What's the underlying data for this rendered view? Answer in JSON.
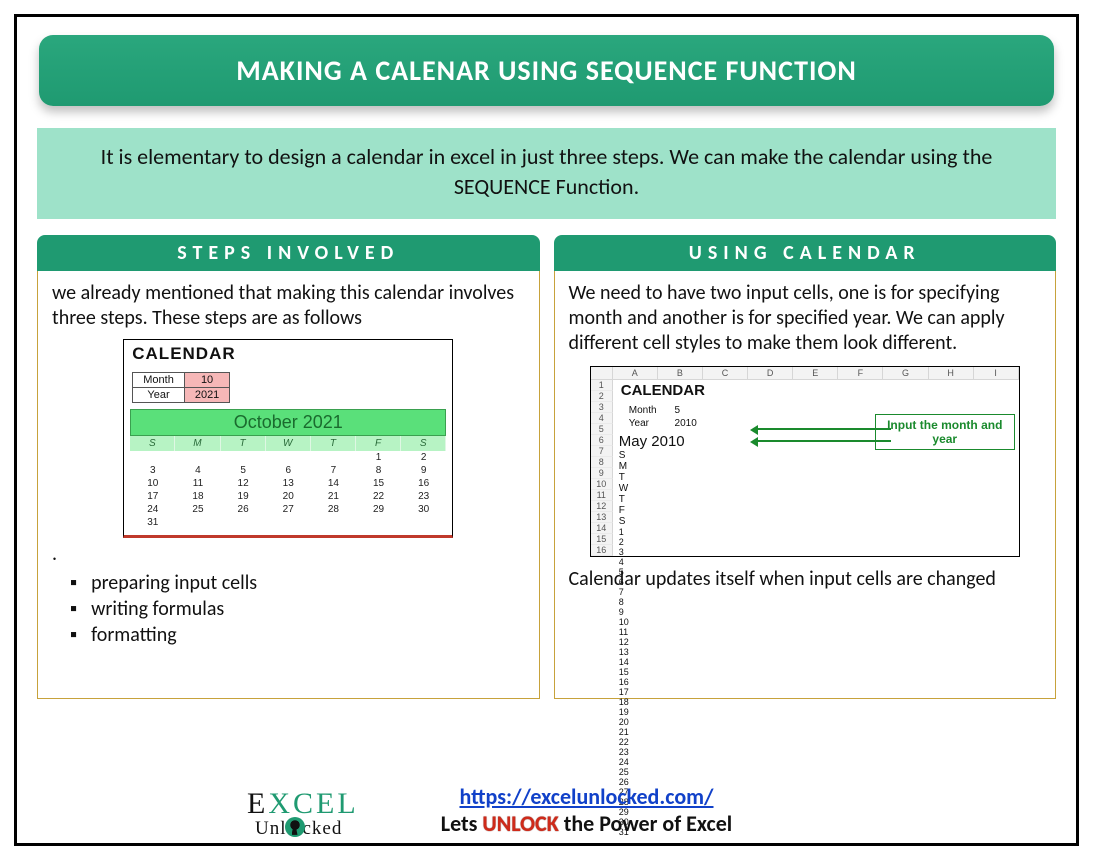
{
  "title": "MAKING A CALENAR USING SEQUENCE FUNCTION",
  "intro": "It is elementary to design a calendar in excel in just three steps. We can make the calendar using the SEQUENCE Function.",
  "left": {
    "header": "STEPS INVOLVED",
    "lead": "we already mentioned that making this calendar involves three steps. These steps are as follows",
    "dot": ".",
    "bullets": [
      "preparing input cells",
      "writing formulas",
      "formatting"
    ],
    "calendar": {
      "title": "CALENDAR",
      "month_label": "Month",
      "year_label": "Year",
      "month_value": "10",
      "year_value": "2021",
      "month_band": "October 2021",
      "dow": [
        "S",
        "M",
        "T",
        "W",
        "T",
        "F",
        "S"
      ],
      "grid": [
        [
          "",
          "",
          "",
          "",
          "",
          "1",
          "2"
        ],
        [
          "3",
          "4",
          "5",
          "6",
          "7",
          "8",
          "9"
        ],
        [
          "10",
          "11",
          "12",
          "13",
          "14",
          "15",
          "16"
        ],
        [
          "17",
          "18",
          "19",
          "20",
          "21",
          "22",
          "23"
        ],
        [
          "24",
          "25",
          "26",
          "27",
          "28",
          "29",
          "30"
        ],
        [
          "31",
          "",
          "",
          "",
          "",
          "",
          ""
        ]
      ]
    }
  },
  "right": {
    "header": "USING CALENDAR",
    "lead": "We need to have two input cells, one is for specifying month and another is for specified year. We can apply different cell styles to make them look different.",
    "trail": "Calendar updates itself when input cells are changed",
    "callout": "Input the month and year",
    "sheet_cols": [
      "",
      "A",
      "B",
      "C",
      "D",
      "E",
      "F",
      "G",
      "H",
      "I"
    ],
    "sheet_rows": [
      "1",
      "2",
      "3",
      "4",
      "5",
      "6",
      "7",
      "8",
      "9",
      "10",
      "11",
      "12",
      "13",
      "14",
      "15",
      "16"
    ],
    "calendar": {
      "title": "CALENDAR",
      "month_label": "Month",
      "year_label": "Year",
      "month_value": "5",
      "year_value": "2010",
      "month_band": "May 2010",
      "dow": [
        "S",
        "M",
        "T",
        "W",
        "T",
        "F",
        "S"
      ],
      "grid": [
        [
          "",
          "",
          "",
          "",
          "",
          "",
          "1"
        ],
        [
          "2",
          "3",
          "4",
          "5",
          "6",
          "7",
          "8"
        ],
        [
          "9",
          "10",
          "11",
          "12",
          "13",
          "14",
          "15"
        ],
        [
          "16",
          "17",
          "18",
          "19",
          "20",
          "21",
          "22"
        ],
        [
          "23",
          "24",
          "25",
          "26",
          "27",
          "28",
          "29"
        ],
        [
          "30",
          "31",
          "",
          "",
          "",
          "",
          ""
        ]
      ]
    }
  },
  "footer": {
    "brand_e": "E",
    "brand_xcel": "XCEL",
    "brand_unl": "Unl",
    "brand_cked": "cked",
    "url": "https://excelunlocked.com/",
    "tag_pre": "Lets ",
    "tag_unlock": "UNLOCK",
    "tag_post": " the Power of Excel"
  }
}
